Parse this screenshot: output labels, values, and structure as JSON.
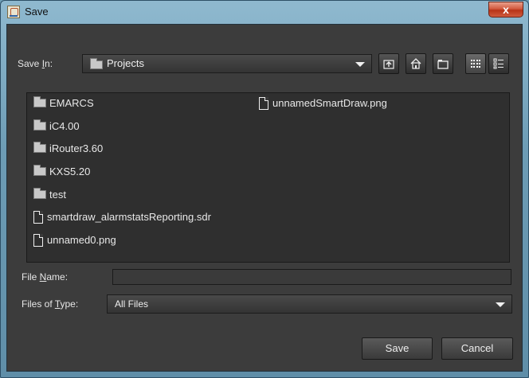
{
  "window": {
    "title": "Save",
    "close_label": "x"
  },
  "save_in": {
    "label_prefix": "Save ",
    "label_mnemonic": "I",
    "label_suffix": "n:",
    "value": "Projects"
  },
  "toolbar": {
    "icons": [
      "up-one-level-icon",
      "home-icon",
      "new-folder-icon",
      "list-view-icon",
      "details-view-icon"
    ]
  },
  "files": {
    "left_column": [
      {
        "type": "folder",
        "name": "EMARCS"
      },
      {
        "type": "folder",
        "name": "iC4.00"
      },
      {
        "type": "folder",
        "name": "iRouter3.60"
      },
      {
        "type": "folder",
        "name": "KXS5.20"
      },
      {
        "type": "folder",
        "name": "test"
      },
      {
        "type": "file",
        "name": "smartdraw_alarmstatsReporting.sdr"
      },
      {
        "type": "file",
        "name": "unnamed0.png"
      }
    ],
    "right_column": [
      {
        "type": "file",
        "name": "unnamedSmartDraw.png"
      }
    ]
  },
  "file_name": {
    "label_prefix": "File ",
    "label_mnemonic": "N",
    "label_suffix": "ame:",
    "value": ""
  },
  "file_type": {
    "label_prefix": "Files of ",
    "label_mnemonic": "T",
    "label_suffix": "ype:",
    "value": "All Files"
  },
  "buttons": {
    "save": "Save",
    "cancel": "Cancel"
  }
}
